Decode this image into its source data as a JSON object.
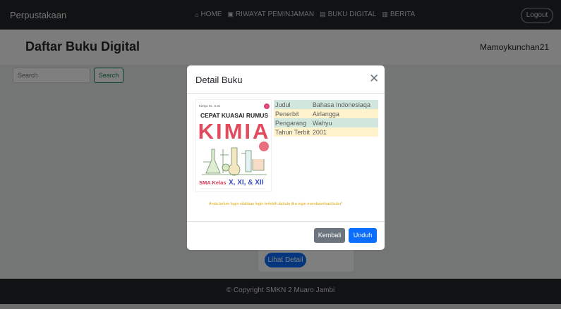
{
  "navbar": {
    "brand": "Perpustakaan",
    "links": [
      {
        "icon": "home-icon",
        "glyph": "⌂",
        "label": "HOME"
      },
      {
        "icon": "book-open-icon",
        "glyph": "▣",
        "label": "RIWAYAT PEMINJAMAN"
      },
      {
        "icon": "book-icon",
        "glyph": "▤",
        "label": "BUKU DIGITAL"
      },
      {
        "icon": "newspaper-icon",
        "glyph": "▥",
        "label": "BERITA"
      }
    ],
    "logout_label": "Logout"
  },
  "header": {
    "title": "Daftar Buku Digital",
    "username": "Mamoykunchan21"
  },
  "search": {
    "placeholder": "Search",
    "button_label": "Search"
  },
  "card": {
    "detail_button_label": "Lihat Detail"
  },
  "footer": {
    "copyright": "© Copyright SMKN 2 Muaro Jambi"
  },
  "modal": {
    "title": "Detail Buku",
    "close_glyph": "✕",
    "cover": {
      "author": "Kenyo M., S.Si",
      "title_line": "CEPAT KUASAI RUMUS",
      "subject": "KIMIA",
      "level_prefix": "SMA Kelas",
      "levels": "X, XI, & XII"
    },
    "info": [
      {
        "label": "Judul",
        "value": "Bahasa Indonesiaqa"
      },
      {
        "label": "Penerbit",
        "value": "Airlangga"
      },
      {
        "label": "Pengarang",
        "value": "Wahyu"
      },
      {
        "label": "Tahun Terbit",
        "value": "2001"
      }
    ],
    "warning": "Anda belum login silahkan login terlebih dahulu jika ingin mendownload buku*",
    "back_label": "Kembali",
    "download_label": "Unduh"
  }
}
